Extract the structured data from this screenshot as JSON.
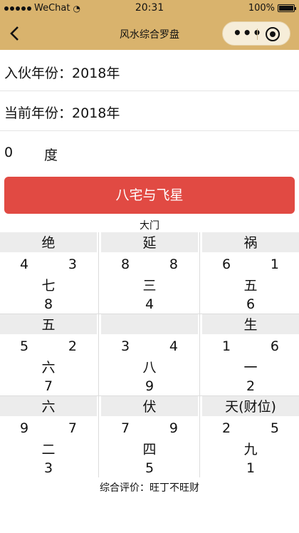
{
  "status_bar": {
    "carrier": "WeChat",
    "time": "20:31",
    "battery": "100%"
  },
  "nav": {
    "title": "风水综合罗盘",
    "back_icon": "chevron-left-icon",
    "more_icon": "more-dots-icon",
    "close_icon": "target-circle-icon"
  },
  "form": {
    "move_in_label": "入伙年份：",
    "move_in_value": "2018年",
    "current_label": "当前年份：",
    "current_value": "2018年",
    "degree_value": "0",
    "degree_unit": "度"
  },
  "button": {
    "label": "八宅与飞星",
    "color": "#e14a43"
  },
  "door_label": "大门",
  "grid": [
    {
      "head": "绝",
      "tl": "4",
      "tr": "3",
      "mid": "七",
      "bot": "8"
    },
    {
      "head": "延",
      "tl": "8",
      "tr": "8",
      "mid": "三",
      "bot": "4"
    },
    {
      "head": "祸",
      "tl": "6",
      "tr": "1",
      "mid": "五",
      "bot": "6"
    },
    {
      "head": "五",
      "tl": "5",
      "tr": "2",
      "mid": "六",
      "bot": "7"
    },
    {
      "head": "",
      "tl": "3",
      "tr": "4",
      "mid": "八",
      "bot": "9"
    },
    {
      "head": "生",
      "tl": "1",
      "tr": "6",
      "mid": "一",
      "bot": "2"
    },
    {
      "head": "六",
      "tl": "9",
      "tr": "7",
      "mid": "二",
      "bot": "3"
    },
    {
      "head": "伏",
      "tl": "7",
      "tr": "9",
      "mid": "四",
      "bot": "5"
    },
    {
      "head": "天(财位)",
      "tl": "2",
      "tr": "5",
      "mid": "九",
      "bot": "1"
    }
  ],
  "summary": "综合评价：旺丁不旺财",
  "colors": {
    "header": "#d9b36d",
    "capsule": "#f6edd9",
    "cell_header": "#ececec"
  }
}
